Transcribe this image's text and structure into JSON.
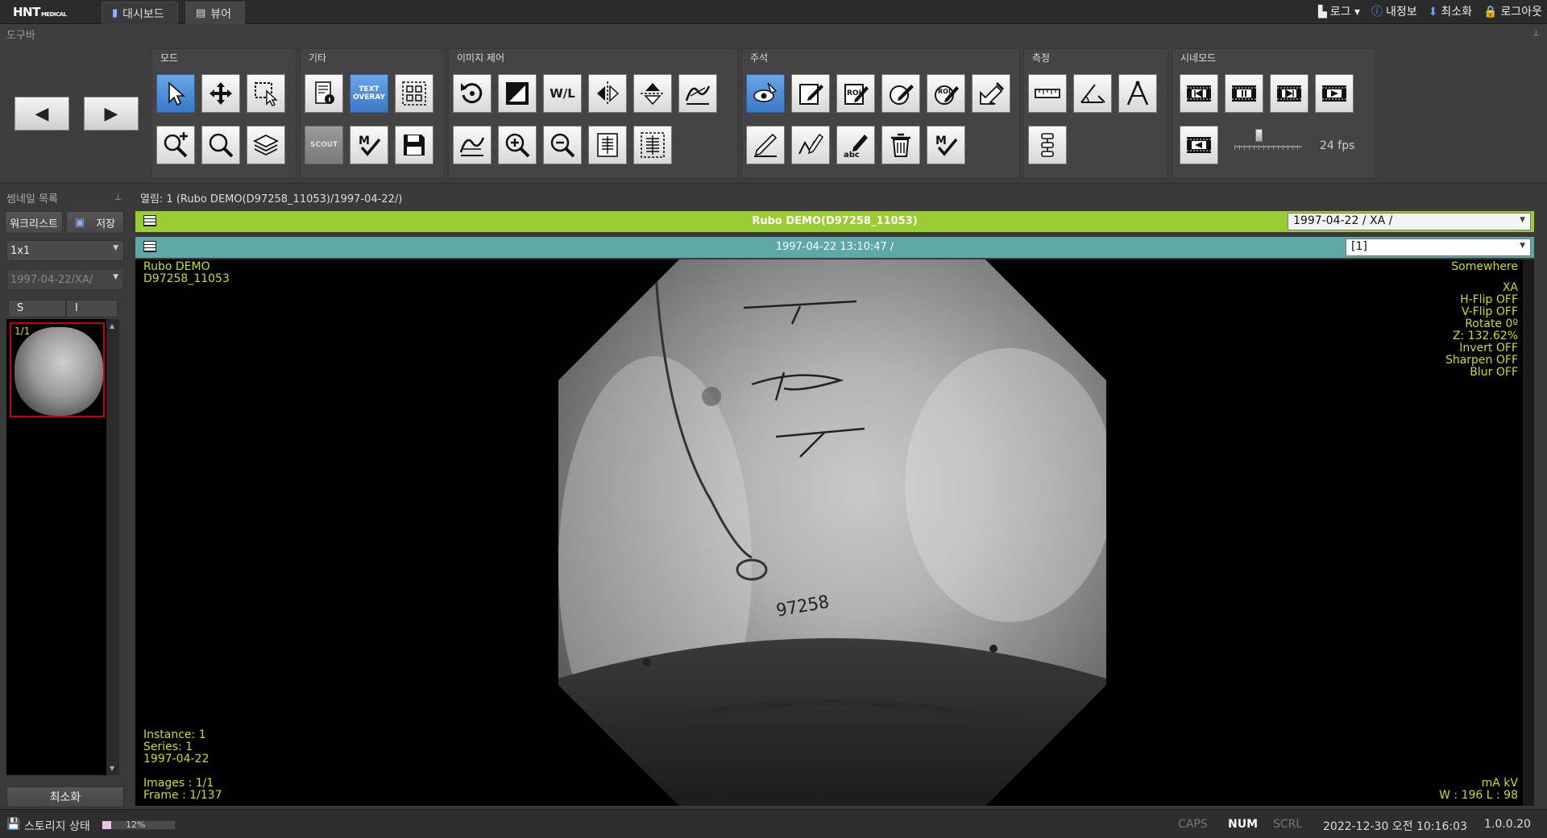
{
  "app": {
    "logo": "HNT",
    "logo_sub": "MEDICAL"
  },
  "tabs": [
    {
      "label": "대시보드"
    },
    {
      "label": "뷰어"
    }
  ],
  "topright": {
    "log": "로그",
    "myinfo": "내정보",
    "minimize": "최소화",
    "logout": "로그아웃"
  },
  "toolbar": {
    "label": "도구바",
    "groups": {
      "mode": "모드",
      "etc": "기타",
      "image_control": "이미지 제어",
      "annotation": "주석",
      "measure": "측정",
      "cine": "시네모드"
    },
    "text_overlay": "TEXT OVERAY",
    "scout": "SCOUT",
    "wl": "W/L",
    "roi": "ROI",
    "abc": "abc",
    "fps": "24 fps",
    "fps_value": 24
  },
  "leftpanel": {
    "title": "썸네일 목록",
    "worklist": "워크리스트",
    "save": "저장",
    "layout_select": "1x1",
    "series_select": "1997-04-22/XA/",
    "tab_s": "S",
    "tab_i": "I",
    "thumb_label": "1/1",
    "minimize": "최소화"
  },
  "main": {
    "open_label": "열림: 1 (Rubo DEMO(D97258_11053)/1997-04-22/)",
    "patient_bar_title": "Rubo DEMO(D97258_11053)",
    "patient_select": "1997-04-22 / XA /",
    "study_bar_title": "1997-04-22 13:10:47 /",
    "study_select": "[1]"
  },
  "overlay": {
    "tl": [
      "Rubo DEMO",
      "D97258_11053"
    ],
    "tr_top": "Somewhere",
    "tr": [
      "XA",
      "H-Flip OFF",
      "V-Flip OFF",
      "Rotate 0º",
      "Z: 132.62%",
      "Invert OFF",
      "Sharpen OFF",
      "Blur OFF"
    ],
    "bl1": [
      "Instance: 1",
      "Series: 1",
      "1997-04-22"
    ],
    "bl2": [
      "Images : 1/1",
      "Frame : 1/137"
    ],
    "br": [
      "mA  kV",
      "W : 196 L : 98"
    ],
    "image_number": "97258"
  },
  "statusbar": {
    "storage": "스토리지 상태",
    "storage_pct": "12%",
    "storage_fraction": 0.12,
    "caps": "CAPS",
    "num": "NUM",
    "scrl": "SCRL",
    "datetime": "2022-12-30 오전 10:16:03",
    "version": "1.0.0.20"
  }
}
